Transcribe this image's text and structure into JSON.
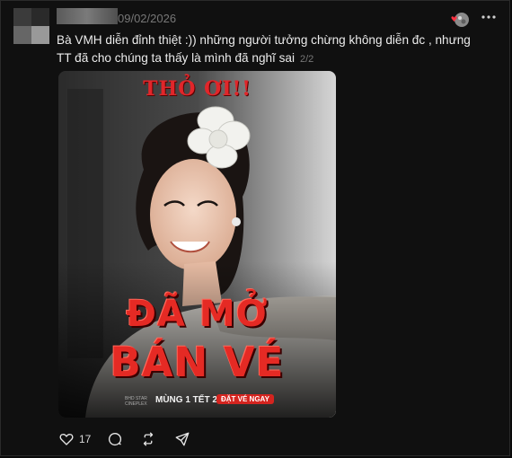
{
  "post": {
    "date": "09/02/2026",
    "text": "Bà VMH diễn đỉnh thiệt :)) những người tưởng chừng không diễn đc , nhưng TT đã cho chúng ta thấy là mình đã nghĩ sai",
    "page_indicator": "2/2"
  },
  "poster": {
    "tagline": "THỎ ƠI!!",
    "headline_line1": "ĐÃ MỞ",
    "headline_line2": "BÁN VÉ",
    "studio": "BHD STAR CINEPLEX",
    "release": "MÙNG 1 TẾT 2026",
    "cta": "ĐẶT VÉ NGAY"
  },
  "actions": {
    "like_count": "17"
  },
  "icons": {
    "react": "heart-reaction-icon",
    "more": "more-horizontal-icon",
    "like": "heart-outline-icon",
    "comment": "comment-icon",
    "repost": "repost-icon",
    "share": "send-icon"
  },
  "colors": {
    "background": "#101010",
    "accent_red": "#e52a24",
    "text": "#ececec",
    "muted": "#777777"
  }
}
